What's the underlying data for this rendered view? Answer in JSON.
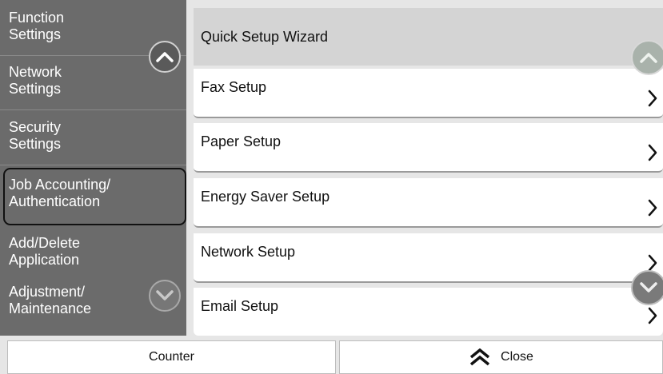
{
  "sidebar": {
    "items": [
      {
        "label": "Function\nSettings"
      },
      {
        "label": "Network\nSettings"
      },
      {
        "label": "Security\nSettings"
      },
      {
        "label": "Job Accounting/\nAuthentication",
        "selected": true
      },
      {
        "label": "Add/Delete\nApplication"
      },
      {
        "label": "Adjustment/\nMaintenance"
      }
    ],
    "scroll_up_icon": "chevron-up-icon",
    "scroll_down_icon": "chevron-down-icon"
  },
  "main": {
    "header": "Quick Setup Wizard",
    "items": [
      {
        "label": "Fax Setup",
        "icon": "chevron-right-icon"
      },
      {
        "label": "Paper Setup",
        "icon": "chevron-right-icon"
      },
      {
        "label": "Energy Saver Setup",
        "icon": "chevron-right-icon"
      },
      {
        "label": "Network Setup",
        "icon": "chevron-right-icon"
      },
      {
        "label": "Email Setup",
        "icon": "chevron-right-icon"
      }
    ]
  },
  "bottom": {
    "counter_label": "Counter",
    "close_label": "Close",
    "close_icon": "double-chevron-up-icon"
  },
  "colors": {
    "sidebar_bg": "#6b6b6b",
    "selected_border": "#111111",
    "list_bg": "#ffffff",
    "header_bg": "#d4d4d4",
    "page_bg": "#e6e6e6"
  }
}
